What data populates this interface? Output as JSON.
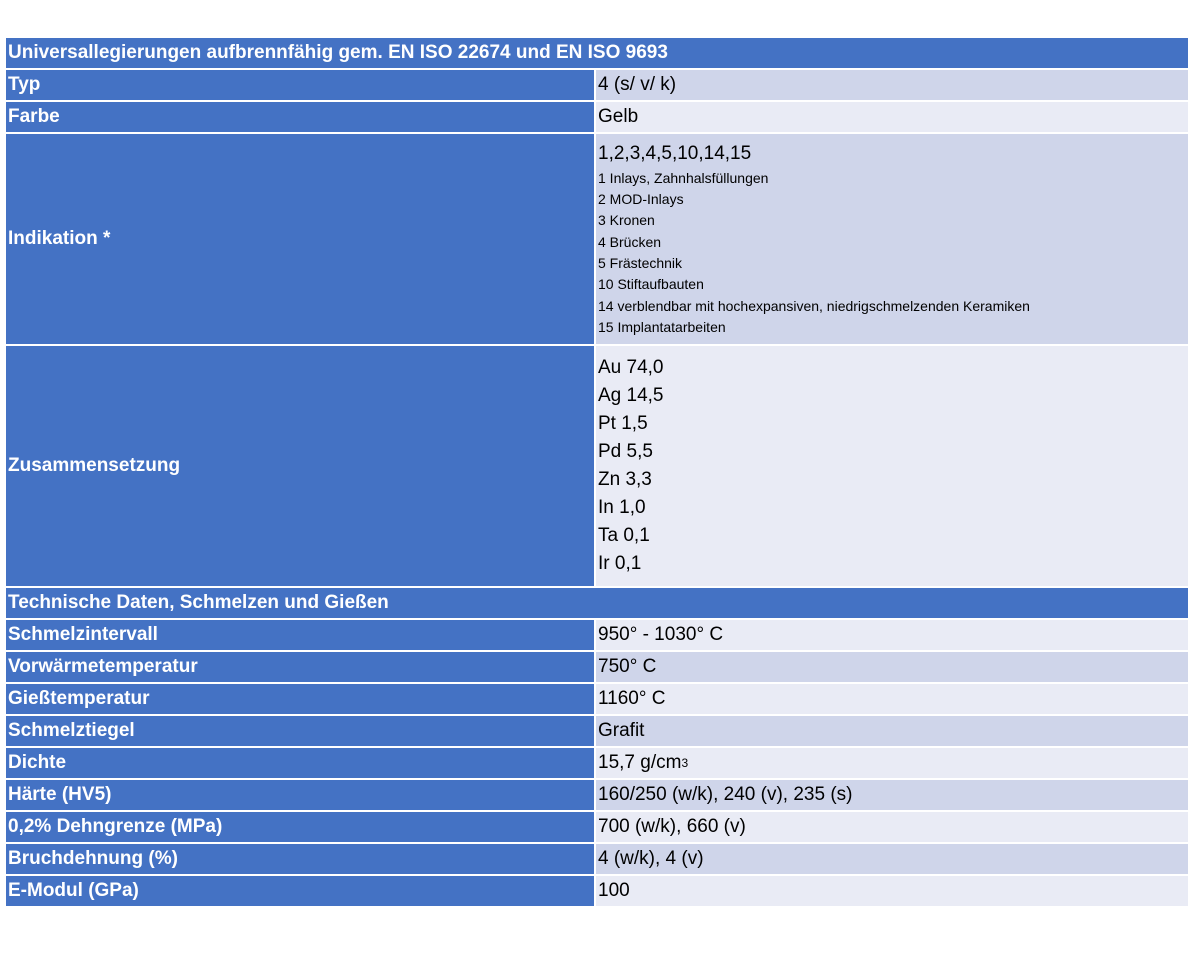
{
  "section1": {
    "title": "Universallegierungen aufbrennfähig gem. EN ISO 22674 und EN ISO 9693",
    "typ": {
      "label": "Typ",
      "value": "4 (s/ v/ k)"
    },
    "farbe": {
      "label": "Farbe",
      "value": "Gelb"
    },
    "indikation": {
      "label": "Indikation *",
      "summary": "1,2,3,4,5,10,14,15",
      "items": [
        "1 Inlays, Zahnhalsfüllungen",
        "2 MOD-Inlays",
        "3 Kronen",
        "4 Brücken",
        "5 Frästechnik",
        "10 Stiftaufbauten",
        "14 verblendbar mit hochexpansiven, niedrigschmelzenden Keramiken",
        "15 Implantatarbeiten"
      ]
    },
    "zusammensetzung": {
      "label": "Zusammensetzung",
      "items": [
        "Au 74,0",
        "Ag 14,5",
        "Pt 1,5",
        "Pd 5,5",
        "Zn 3,3",
        "In 1,0",
        "Ta 0,1",
        "Ir 0,1"
      ]
    }
  },
  "section2": {
    "title": "Technische Daten, Schmelzen und Gießen",
    "rows": [
      {
        "label": "Schmelzintervall",
        "value": "950° - 1030° C"
      },
      {
        "label": "Vorwärmetemperatur",
        "value": "750° C"
      },
      {
        "label": "Gießtemperatur",
        "value": "1160° C"
      },
      {
        "label": "Schmelztiegel",
        "value": "Grafit"
      },
      {
        "label": "Dichte",
        "value": "15,7 g/cm",
        "sup": "3"
      },
      {
        "label": "Härte (HV5)",
        "value": "160/250 (w/k), 240 (v), 235 (s)"
      },
      {
        "label": "0,2% Dehngrenze (MPa)",
        "value": "700 (w/k), 660 (v)"
      },
      {
        "label": "Bruchdehnung (%)",
        "value": "4 (w/k), 4 (v)"
      },
      {
        "label": "E-Modul (GPa)",
        "value": "100"
      }
    ]
  }
}
